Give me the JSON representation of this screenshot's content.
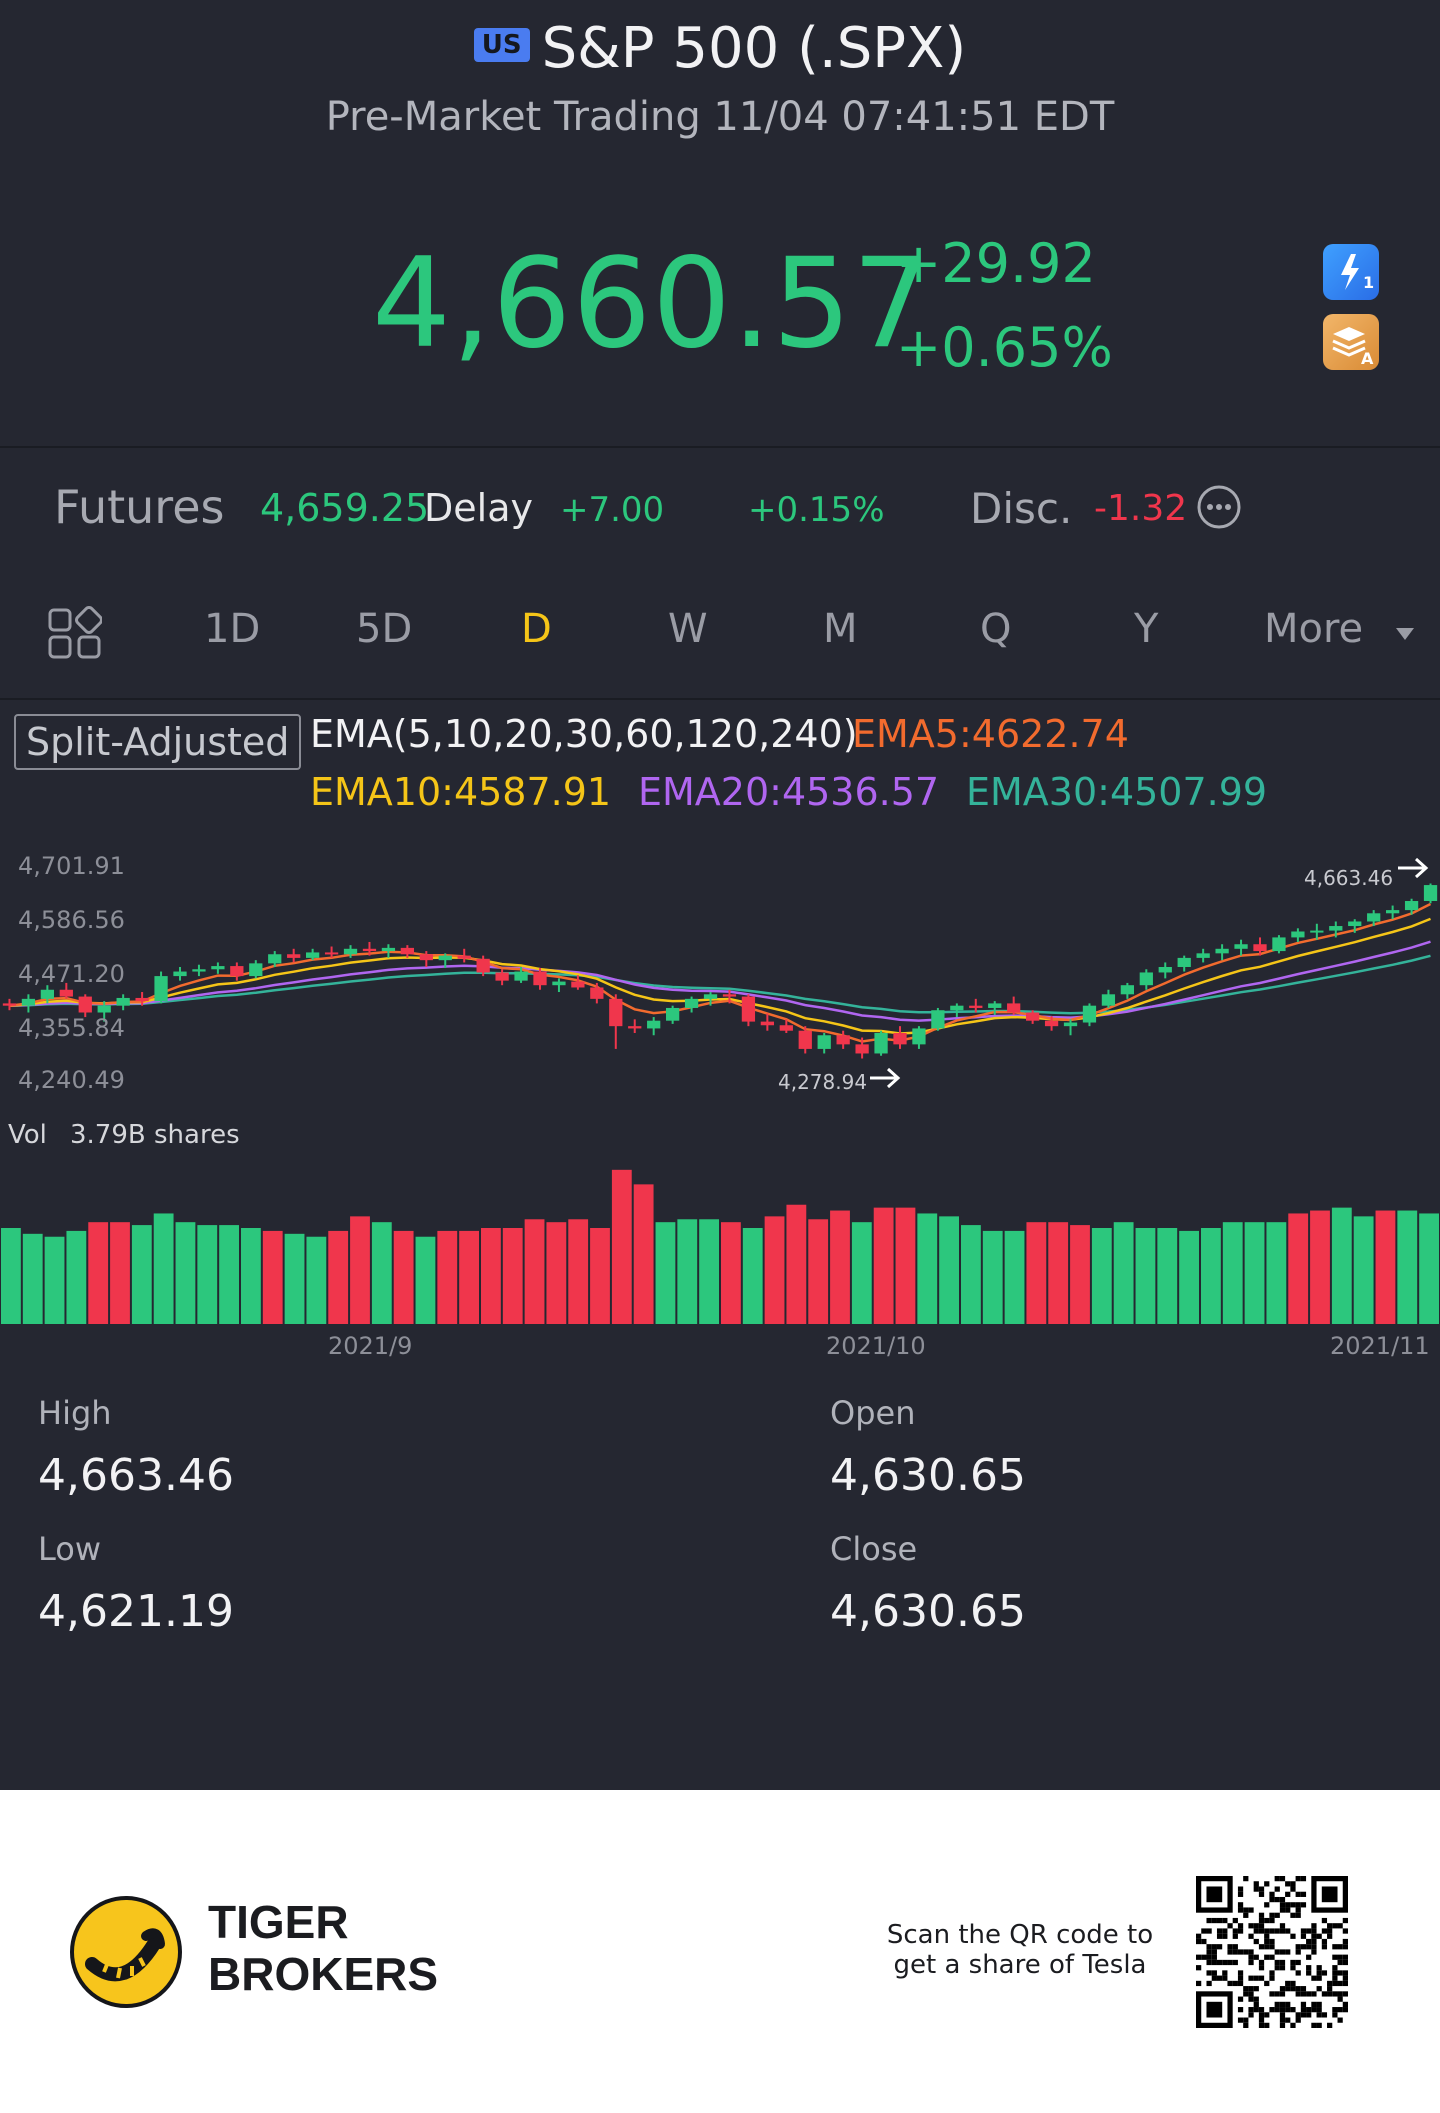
{
  "header": {
    "market_badge": "US",
    "title": "S&P 500 (.SPX)",
    "subtitle": "Pre-Market Trading 11/04 07:41:51 EDT",
    "price": "4,660.57",
    "change_abs": "+29.92",
    "change_pct": "+0.65%",
    "icons": [
      "flash-quote-icon",
      "layers-a-icon"
    ]
  },
  "futures": {
    "label": "Futures",
    "value": "4,659.25",
    "delay": "Delay",
    "change": "+7.00",
    "change_pct": "+0.15%",
    "disc_label": "Disc.",
    "disc_value": "-1.32",
    "more_icon": "more-dots-icon"
  },
  "tabs": {
    "items": [
      "1D",
      "5D",
      "D",
      "W",
      "M",
      "Q",
      "Y",
      "More"
    ],
    "active": "D",
    "layout_icon": "grid-layout-icon",
    "more_dropdown_icon": "triangle-down-icon"
  },
  "indicators": {
    "split_adjusted": "Split-Adjusted",
    "ema_title": "EMA(5,10,20,30,60,120,240)",
    "ema5": "EMA5:4622.74",
    "ema10": "EMA10:4587.91",
    "ema20": "EMA20:4536.57",
    "ema30": "EMA30:4507.99"
  },
  "colors": {
    "up": "#2cc77d",
    "down": "#f0364c",
    "ema5": "#f26b2e",
    "ema10": "#f5c518",
    "ema20": "#b066f0",
    "ema30": "#34b39a",
    "active_tab": "#f5c518"
  },
  "chart_data": {
    "type": "candlestick",
    "y_ticks": [
      "4,701.91",
      "4,586.56",
      "4,471.20",
      "4,355.84",
      "4,240.49"
    ],
    "ylim": [
      4240.49,
      4701.91
    ],
    "x_ticks": [
      "2021/9",
      "2021/10",
      "2021/11"
    ],
    "high_marker": "4,663.46",
    "low_marker": "4,278.94",
    "candles": [
      [
        4400,
        4410,
        4385,
        4395
      ],
      [
        4395,
        4420,
        4380,
        4410
      ],
      [
        4410,
        4440,
        4400,
        4430
      ],
      [
        4430,
        4445,
        4410,
        4415
      ],
      [
        4415,
        4420,
        4370,
        4380
      ],
      [
        4380,
        4405,
        4360,
        4395
      ],
      [
        4395,
        4420,
        4385,
        4412
      ],
      [
        4412,
        4425,
        4395,
        4405
      ],
      [
        4405,
        4470,
        4400,
        4460
      ],
      [
        4460,
        4480,
        4450,
        4470
      ],
      [
        4470,
        4485,
        4460,
        4475
      ],
      [
        4475,
        4490,
        4465,
        4482
      ],
      [
        4482,
        4490,
        4450,
        4460
      ],
      [
        4460,
        4495,
        4455,
        4488
      ],
      [
        4488,
        4515,
        4480,
        4508
      ],
      [
        4508,
        4520,
        4490,
        4500
      ],
      [
        4500,
        4520,
        4495,
        4512
      ],
      [
        4512,
        4525,
        4500,
        4508
      ],
      [
        4508,
        4528,
        4500,
        4520
      ],
      [
        4520,
        4535,
        4505,
        4515
      ],
      [
        4515,
        4530,
        4500,
        4522
      ],
      [
        4522,
        4528,
        4500,
        4508
      ],
      [
        4508,
        4515,
        4480,
        4495
      ],
      [
        4495,
        4510,
        4478,
        4505
      ],
      [
        4505,
        4520,
        4490,
        4498
      ],
      [
        4498,
        4505,
        4460,
        4468
      ],
      [
        4468,
        4475,
        4440,
        4450
      ],
      [
        4450,
        4480,
        4445,
        4470
      ],
      [
        4470,
        4478,
        4430,
        4440
      ],
      [
        4440,
        4455,
        4425,
        4448
      ],
      [
        4448,
        4462,
        4430,
        4435
      ],
      [
        4435,
        4445,
        4400,
        4410
      ],
      [
        4410,
        4420,
        4300,
        4350
      ],
      [
        4350,
        4365,
        4335,
        4345
      ],
      [
        4345,
        4370,
        4330,
        4362
      ],
      [
        4362,
        4395,
        4355,
        4390
      ],
      [
        4390,
        4415,
        4380,
        4410
      ],
      [
        4410,
        4425,
        4395,
        4420
      ],
      [
        4420,
        4430,
        4400,
        4415
      ],
      [
        4415,
        4420,
        4350,
        4360
      ],
      [
        4360,
        4378,
        4340,
        4352
      ],
      [
        4352,
        4365,
        4335,
        4340
      ],
      [
        4340,
        4350,
        4290,
        4300
      ],
      [
        4300,
        4335,
        4290,
        4330
      ],
      [
        4330,
        4340,
        4300,
        4310
      ],
      [
        4310,
        4325,
        4278.94,
        4290
      ],
      [
        4290,
        4340,
        4285,
        4335
      ],
      [
        4335,
        4350,
        4300,
        4310
      ],
      [
        4310,
        4350,
        4300,
        4345
      ],
      [
        4345,
        4390,
        4340,
        4385
      ],
      [
        4385,
        4400,
        4370,
        4395
      ],
      [
        4395,
        4410,
        4380,
        4390
      ],
      [
        4390,
        4405,
        4375,
        4400
      ],
      [
        4400,
        4415,
        4375,
        4380
      ],
      [
        4380,
        4385,
        4355,
        4362
      ],
      [
        4362,
        4372,
        4340,
        4350
      ],
      [
        4350,
        4365,
        4330,
        4358
      ],
      [
        4358,
        4400,
        4350,
        4395
      ],
      [
        4395,
        4430,
        4390,
        4420
      ],
      [
        4420,
        4445,
        4410,
        4440
      ],
      [
        4440,
        4475,
        4430,
        4468
      ],
      [
        4468,
        4490,
        4455,
        4480
      ],
      [
        4480,
        4505,
        4470,
        4500
      ],
      [
        4500,
        4520,
        4490,
        4510
      ],
      [
        4510,
        4530,
        4495,
        4520
      ],
      [
        4520,
        4540,
        4505,
        4530
      ],
      [
        4530,
        4545,
        4505,
        4515
      ],
      [
        4515,
        4550,
        4510,
        4545
      ],
      [
        4545,
        4565,
        4535,
        4558
      ],
      [
        4558,
        4575,
        4540,
        4560
      ],
      [
        4560,
        4580,
        4545,
        4570
      ],
      [
        4570,
        4585,
        4555,
        4580
      ],
      [
        4580,
        4605,
        4570,
        4598
      ],
      [
        4598,
        4615,
        4585,
        4605
      ],
      [
        4605,
        4630,
        4595,
        4625
      ],
      [
        4625,
        4663.46,
        4620,
        4660
      ]
    ],
    "volume_label": "Vol",
    "volume_value": "3.79B shares",
    "volumes": [
      3.3,
      3.1,
      3.0,
      3.2,
      3.5,
      3.5,
      3.4,
      3.8,
      3.5,
      3.4,
      3.4,
      3.3,
      3.2,
      3.1,
      3.0,
      3.2,
      3.7,
      3.5,
      3.2,
      3.0,
      3.2,
      3.2,
      3.3,
      3.3,
      3.6,
      3.5,
      3.6,
      3.3,
      5.3,
      4.8,
      3.5,
      3.6,
      3.6,
      3.5,
      3.3,
      3.7,
      4.1,
      3.6,
      3.9,
      3.5,
      4.0,
      4.0,
      3.8,
      3.7,
      3.4,
      3.2,
      3.2,
      3.5,
      3.5,
      3.4,
      3.3,
      3.5,
      3.3,
      3.3,
      3.2,
      3.3,
      3.5,
      3.5,
      3.5,
      3.8,
      3.9,
      4.0,
      3.7,
      3.9,
      3.9,
      3.8
    ],
    "volume_up": [
      1,
      1,
      1,
      1,
      0,
      0,
      1,
      1,
      1,
      1,
      1,
      1,
      0,
      1,
      1,
      0,
      0,
      1,
      0,
      1,
      0,
      0,
      0,
      0,
      0,
      0,
      0,
      0,
      0,
      0,
      1,
      1,
      1,
      0,
      1,
      0,
      0,
      0,
      0,
      1,
      0,
      0,
      1,
      1,
      1,
      1,
      1,
      0,
      0,
      0,
      1,
      1,
      1,
      1,
      1,
      1,
      1,
      1,
      1,
      0,
      0,
      1,
      1,
      0,
      1,
      1
    ]
  },
  "stats": {
    "high_label": "High",
    "high_value": "4,663.46",
    "open_label": "Open",
    "open_value": "4,630.65",
    "low_label": "Low",
    "low_value": "4,621.19",
    "close_label": "Close",
    "close_value": "4,630.65"
  },
  "footer": {
    "brand_line1": "TIGER",
    "brand_line2": "BROKERS",
    "qr_line1": "Scan the QR code to",
    "qr_line2": "get a share of Tesla"
  }
}
